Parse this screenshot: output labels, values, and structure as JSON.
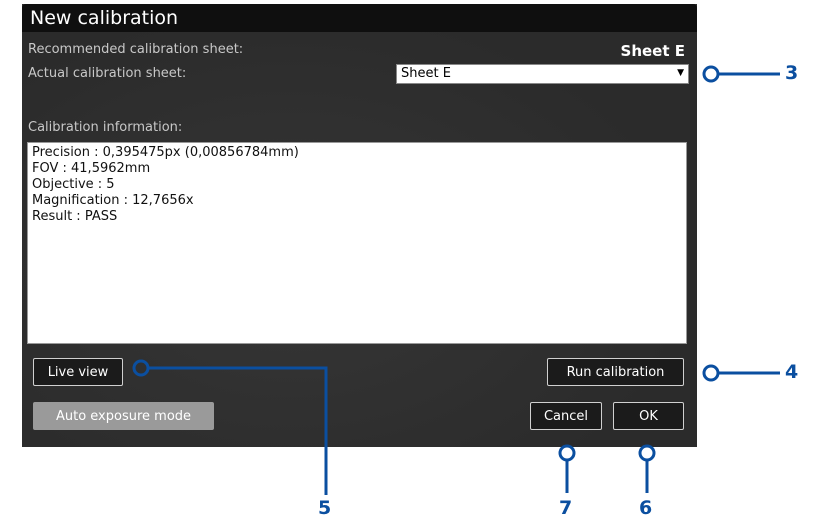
{
  "dialog": {
    "title": "New calibration",
    "recommended_label": "Recommended calibration sheet:",
    "recommended_value": "Sheet E",
    "actual_label": "Actual calibration sheet:",
    "actual_select_value": "Sheet E",
    "info_label": "Calibration information:",
    "info_lines": [
      "Precision : 0,395475px (0,00856784mm)",
      "FOV : 41,5962mm",
      "Objective : 5",
      "Magnification : 12,7656x",
      "",
      "",
      "Result : PASS"
    ],
    "buttons": {
      "live_view": "Live view",
      "run_calibration": "Run calibration",
      "auto_exposure": "Auto exposure mode",
      "cancel": "Cancel",
      "ok": "OK"
    }
  },
  "callouts": {
    "c3": "3",
    "c4": "4",
    "c5": "5",
    "c6": "6",
    "c7": "7"
  },
  "colors": {
    "callout": "#0b4fa0",
    "dialog_bg": "#2e2e2e",
    "titlebar": "#0f0f0f"
  }
}
